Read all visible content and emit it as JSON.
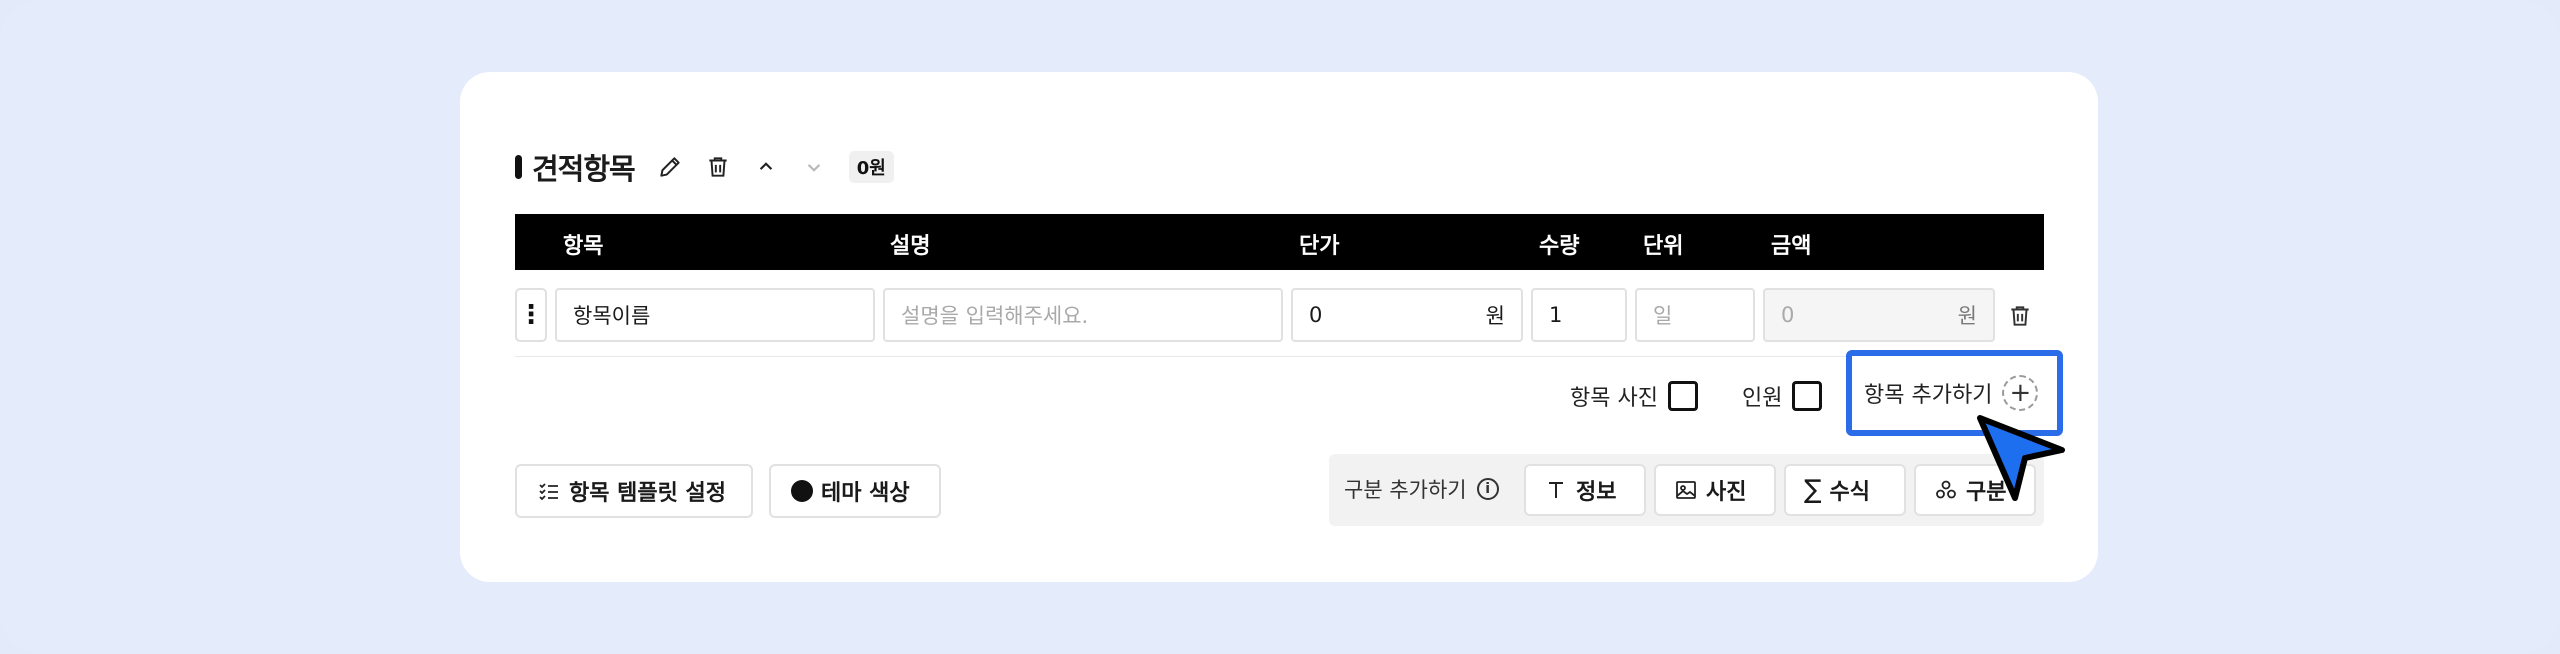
{
  "section": {
    "title": "견적항목",
    "total_badge": "0원"
  },
  "table": {
    "headers": {
      "item": "항목",
      "description": "설명",
      "unit_price": "단가",
      "quantity": "수량",
      "unit": "단위",
      "amount": "금액"
    },
    "rows": [
      {
        "item_name": "항목이름",
        "description_placeholder": "설명을 입력해주세요.",
        "unit_price": "0",
        "unit_price_suffix": "원",
        "quantity": "1",
        "unit_placeholder": "일",
        "amount": "0",
        "amount_suffix": "원"
      }
    ]
  },
  "options": {
    "photo_label": "항목 사진",
    "person_label": "인원",
    "add_item_label": "항목 추가하기"
  },
  "footer": {
    "template_button": "항목 템플릿 설정",
    "theme_button": "테마 색상",
    "add_section_label": "구분 추가하기",
    "section_types": {
      "info": "정보",
      "photo": "사진",
      "formula": "수식",
      "group": "구분"
    }
  },
  "colors": {
    "highlight": "#2b6de8",
    "background": "#e3ebfb",
    "header_bg": "#000000"
  }
}
